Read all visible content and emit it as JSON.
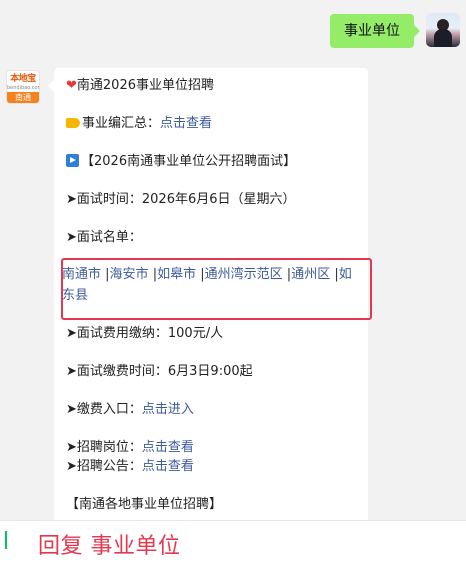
{
  "user_message": "事业单位",
  "account": {
    "avatar_brand": "本地宝",
    "avatar_domain": "bendibao.com",
    "avatar_city": "南通"
  },
  "message": {
    "title": "南通2026事业单位招聘",
    "summary_label": "事业编汇总：",
    "summary_link": "点击查看",
    "section_heading": "【2026南通事业单位公开招聘面试】",
    "interview_time": "➤面试时间：2026年6月6日（星期六）",
    "interview_list_label": "➤面试名单：",
    "name_list": [
      {
        "text": "南通市"
      },
      {
        "text": "海安市"
      },
      {
        "text": "如皋市"
      },
      {
        "text": "通州湾示范区"
      },
      {
        "text": "通州区"
      },
      {
        "text": "如东县"
      }
    ],
    "separator": "|",
    "fee_line": "➤面试费用缴纳：100元/人",
    "fee_time_line": "➤面试缴费时间：6月3日9:00起",
    "fee_entry_label": "➤缴费入口：",
    "fee_entry_link": "点击进入",
    "positions_label": "➤招聘岗位：",
    "positions_link": "点击查看",
    "notice_label": "➤招聘公告：",
    "notice_link": "点击查看",
    "local_heading": "【南通各地事业单位招聘】"
  },
  "reply_bar": {
    "text": "回复 事业单位"
  },
  "colors": {
    "bubble_green": "#95ec69",
    "link_blue": "#3c5b9c",
    "highlight_red": "#e5384f",
    "reply_red": "#e5384f"
  }
}
